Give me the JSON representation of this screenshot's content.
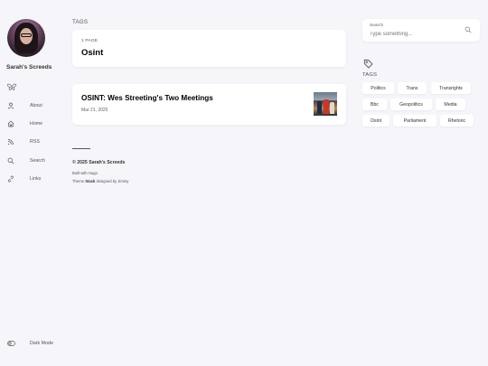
{
  "sidebar": {
    "site_name": "Sarah's Screeds",
    "social_icon": "butterfly-icon",
    "menu": [
      {
        "label": "About",
        "icon": "user-icon"
      },
      {
        "label": "Home",
        "icon": "home-icon"
      },
      {
        "label": "RSS",
        "icon": "rss-icon"
      },
      {
        "label": "Search",
        "icon": "search-icon"
      },
      {
        "label": "Links",
        "icon": "link-icon"
      }
    ],
    "dark_mode_label": "Dark Mode"
  },
  "main": {
    "section_label": "TAGS",
    "header": {
      "page_count": "1 PAGE",
      "title": "Osint"
    },
    "articles": [
      {
        "title": "OSINT: Wes Streeting's Two Meetings",
        "date": "Mar 21, 2025"
      }
    ]
  },
  "footer": {
    "copyright": "© 2025 Sarah's Screeds",
    "built_with": "Built with Hugo",
    "theme_prefix": "Theme ",
    "theme_name": "Stack",
    "theme_suffix": " designed by Jimmy"
  },
  "right": {
    "search": {
      "label": "Search",
      "placeholder": "Type something..."
    },
    "tags_label": "TAGS",
    "tags": [
      "Politics",
      "Trans",
      "Transrights",
      "Bbc",
      "Geopolitics",
      "Media",
      "Osint",
      "Parliament",
      "Rhetoric"
    ]
  },
  "colors": {
    "background": "#f5f5fa",
    "card": "#ffffff",
    "text": "#000000",
    "muted": "#555555"
  }
}
